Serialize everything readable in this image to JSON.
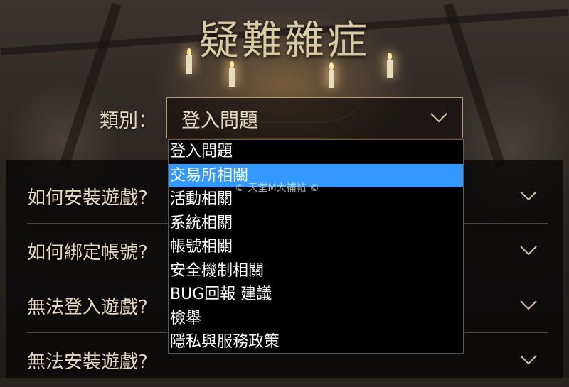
{
  "header": {
    "title": "疑難雜症"
  },
  "category": {
    "label": "類別：",
    "selected_value": "登入問題",
    "options": [
      "登入問題",
      "交易所相關",
      "活動相關",
      "系統相關",
      "帳號相關",
      "安全機制相關",
      "BUG回報 建議",
      "檢舉",
      "隱私與服務政策"
    ],
    "highlighted_option": "交易所相關"
  },
  "faq": {
    "items": [
      {
        "question": "如何安裝遊戲?"
      },
      {
        "question": "如何綁定帳號?"
      },
      {
        "question": "無法登入遊戲?"
      },
      {
        "question": "無法安裝遊戲?"
      }
    ]
  },
  "watermark": {
    "text": "© 天堂M大補帖 ©"
  },
  "colors": {
    "accent_gold": "#b89a66",
    "text_cream": "#e6d8bc",
    "highlight_blue": "#3399ff",
    "dropdown_bg": "#000000"
  }
}
